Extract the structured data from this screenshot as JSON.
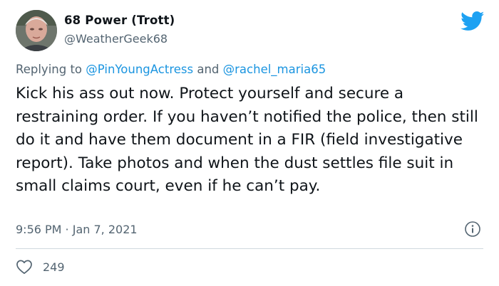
{
  "tweet": {
    "author_name": "68 Power (Trott)",
    "author_handle": "@WeatherGeek68",
    "replying_to_prefix": "Replying to ",
    "mention_1": "@PinYoungActress",
    "replying_joiner": " and ",
    "mention_2": "@rachel_maria65",
    "text": "Kick his ass out now. Protect yourself and secure a restraining order. If you haven’t notified the police, then still do it and have them document in a FIR (field investigative report). Take photos and when the dust settles file suit in small claims court, even if he can’t pay.",
    "time": "9:56 PM",
    "separator": " · ",
    "date": "Jan 7, 2021",
    "like_count": "249"
  },
  "icons": {
    "brand": "twitter-bird-icon",
    "info": "info-icon",
    "like": "heart-icon"
  },
  "colors": {
    "brand_blue": "#1da1f2",
    "mention_blue": "#1b95e0",
    "secondary_text": "#536471",
    "primary_text": "#0f1419",
    "divider": "#cfd9de"
  }
}
